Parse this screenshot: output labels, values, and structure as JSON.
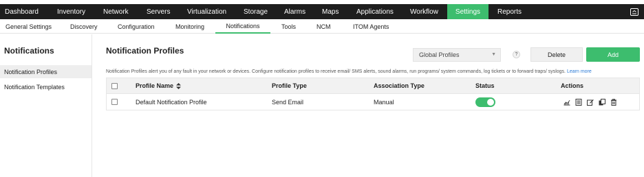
{
  "main_nav": {
    "items": [
      "Dashboard",
      "Inventory",
      "Network",
      "Servers",
      "Virtualization",
      "Storage",
      "Alarms",
      "Maps",
      "Applications",
      "Workflow",
      "Settings",
      "Reports"
    ],
    "active": "Settings"
  },
  "sub_nav": {
    "items": [
      "General Settings",
      "Discovery",
      "Configuration",
      "Monitoring",
      "Notifications",
      "Tools",
      "NCM",
      "ITOM Agents"
    ],
    "active": "Notifications"
  },
  "sidebar": {
    "title": "Notifications",
    "items": [
      "Notification Profiles",
      "Notification Templates"
    ],
    "active": "Notification Profiles"
  },
  "page": {
    "title": "Notification Profiles",
    "filter_value": "Global Profiles",
    "help": "?",
    "delete_label": "Delete",
    "add_label": "Add",
    "description": "Notification Profiles alert you of any fault in your network or devices. Configure notification profiles to receive email/ SMS alerts, sound alarms, run programs/ system commands, log tickets or to forward traps/ syslogs.",
    "learn_more": "Learn more"
  },
  "table": {
    "columns": [
      "Profile Name",
      "Profile Type",
      "Association Type",
      "Status",
      "Actions"
    ],
    "rows": [
      {
        "profile_name": "Default Notification Profile",
        "profile_type": "Send Email",
        "association_type": "Manual",
        "status": "enabled"
      }
    ]
  },
  "colors": {
    "accent": "#3dbd6e",
    "nav_bg": "#1e1e1e",
    "link": "#2a7ad6"
  }
}
